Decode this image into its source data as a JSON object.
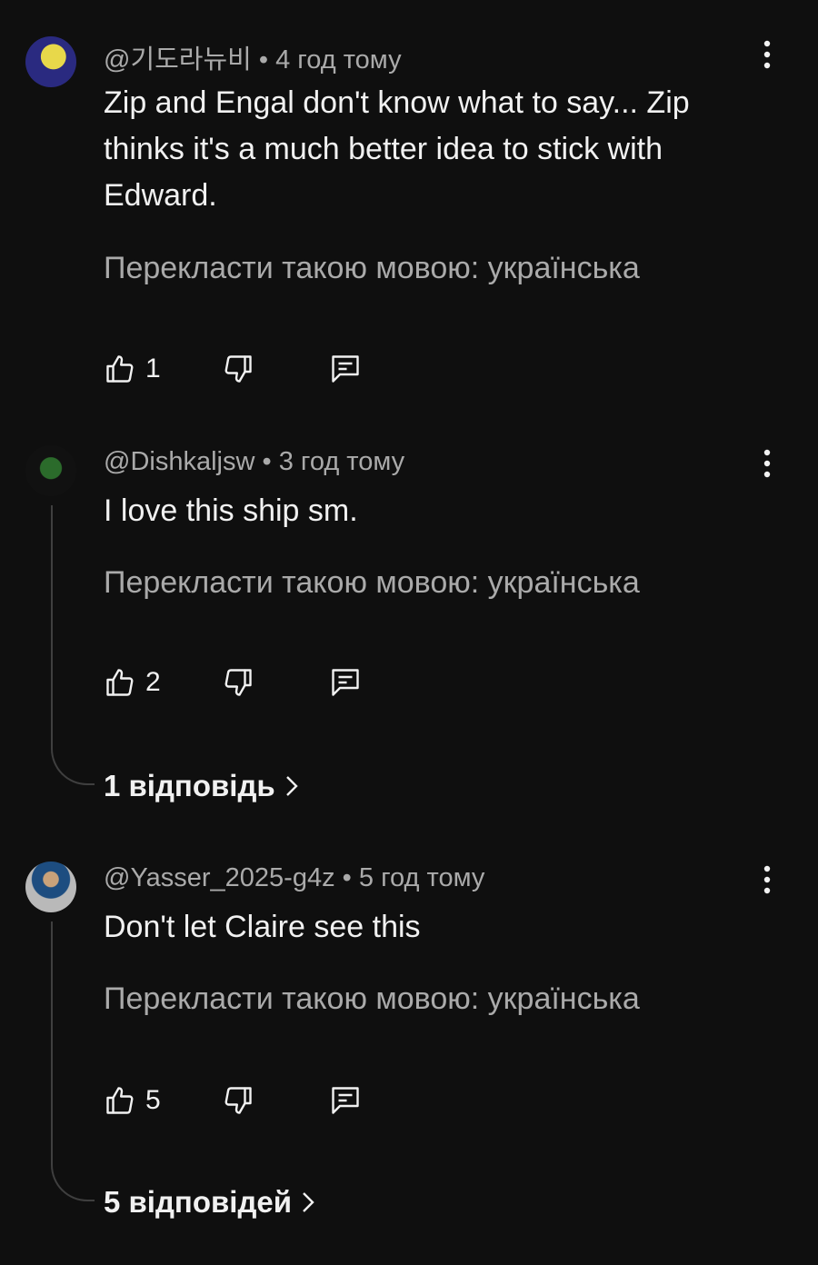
{
  "comments": [
    {
      "author": "@기도라뉴비",
      "time": "4 год тому",
      "text": "Zip and Engal don't know what to say... Zip thinks it's a much better idea to stick with Edward.",
      "translate": "Перекласти такою мовою: українська",
      "likes": "1"
    },
    {
      "author": "@Dishkaljsw",
      "time": "3 год тому",
      "text": "I love this ship sm.",
      "translate": "Перекласти такою мовою: українська",
      "likes": "2",
      "replies": "1 відповідь"
    },
    {
      "author": "@Yasser_2025-g4z",
      "time": "5 год тому",
      "text": "Don't let Claire see this",
      "translate": "Перекласти такою мовою: українська",
      "likes": "5",
      "replies": "5 відповідей"
    }
  ],
  "separator": " • ",
  "icons": {
    "like": "thumbs-up-icon",
    "dislike": "thumbs-down-icon",
    "reply": "reply-icon",
    "menu": "more-vert-icon",
    "chevron": "chevron-right-icon"
  },
  "colors": {
    "background": "#0f0f0f",
    "primary_text": "#f1f1f1",
    "secondary_text": "#aaaaaa"
  }
}
